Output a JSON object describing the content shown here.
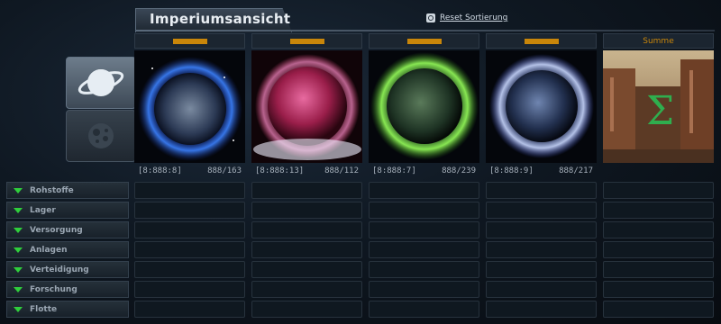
{
  "header": {
    "title": "Imperiumsansicht",
    "reset_label": "Reset Sortierung"
  },
  "planets": [
    {
      "coords": "[8:888:8]",
      "stats": "888/163"
    },
    {
      "coords": "[8:888:13]",
      "stats": "888/112"
    },
    {
      "coords": "[8:888:7]",
      "stats": "888/239"
    },
    {
      "coords": "[8:888:9]",
      "stats": "888/217"
    }
  ],
  "summary": {
    "label": "Summe"
  },
  "categories": [
    "Rohstoffe",
    "Lager",
    "Versorgung",
    "Anlagen",
    "Verteidigung",
    "Forschung",
    "Flotte"
  ],
  "colors": {
    "accent": "#c9860a",
    "expand": "#2fcf3c"
  }
}
